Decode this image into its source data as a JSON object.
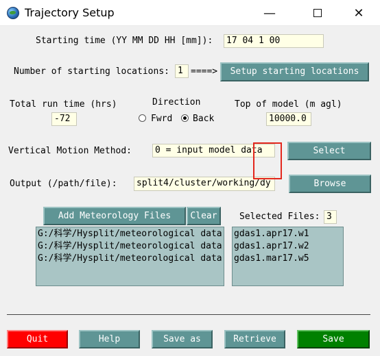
{
  "window": {
    "title": "Trajectory Setup",
    "min_glyph": "—",
    "close_glyph": "✕"
  },
  "starting_time": {
    "label": "Starting time (YY MM DD HH [mm]):",
    "value": "17 04 1 00"
  },
  "locations": {
    "label": "Number of starting locations:",
    "value": "1",
    "arrow": "====>",
    "setup_button": "Setup starting locations"
  },
  "run_time": {
    "label": "Total run time (hrs)",
    "value": "-72"
  },
  "direction": {
    "label": "Direction",
    "options": [
      "Fwrd",
      "Back"
    ],
    "selected": "Back"
  },
  "top_of_model": {
    "label": "Top of model (m agl)",
    "value": "10000.0"
  },
  "vertical_motion": {
    "label": "Vertical Motion Method:",
    "value": "0 = input model data",
    "select_button": "Select"
  },
  "output": {
    "label": "Output (/path/file):",
    "value": "split4/cluster/working/dy",
    "browse_button": "Browse"
  },
  "meteorology": {
    "add_button": "Add Meteorology Files",
    "clear_button": "Clear",
    "selected_label": "Selected Files:",
    "selected_count": "3",
    "paths": [
      "G:/科学/Hysplit/meteorological data",
      "G:/科学/Hysplit/meteorological data",
      "G:/科学/Hysplit/meteorological data"
    ],
    "files": [
      "gdas1.apr17.w1",
      "gdas1.apr17.w2",
      "gdas1.mar17.w5"
    ]
  },
  "actions": {
    "quit": "Quit",
    "help": "Help",
    "save_as": "Save as",
    "retrieve": "Retrieve",
    "save": "Save"
  },
  "colors": {
    "button": "#5f9595",
    "quit": "#ff0000",
    "save": "#008000",
    "entry_bg": "#ffffe6",
    "list_bg": "#a9c5c5",
    "annotation": "#e3261c"
  }
}
